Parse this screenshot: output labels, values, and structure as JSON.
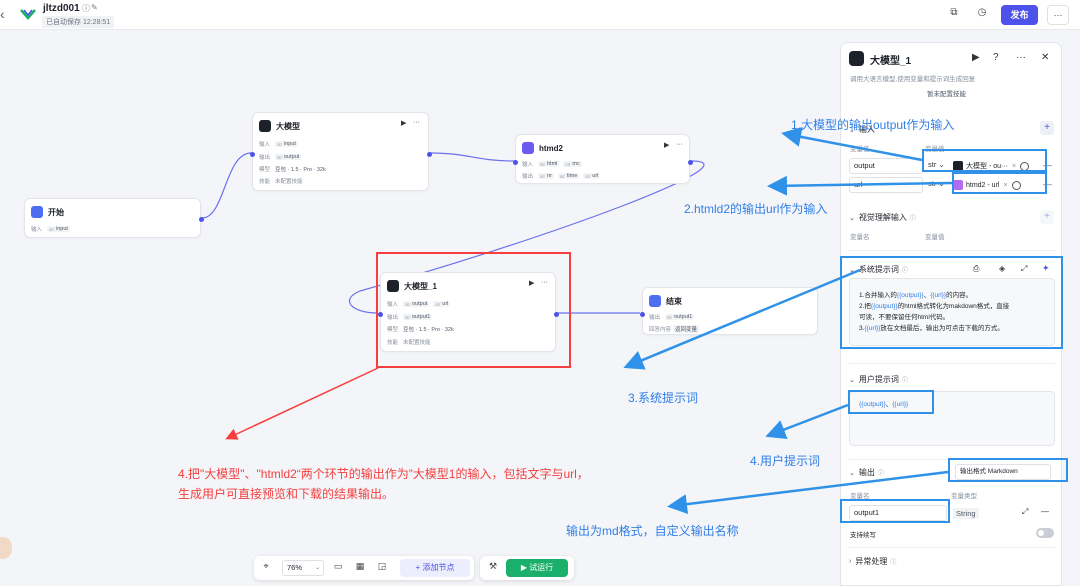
{
  "topbar": {
    "project_name": "jltzd001",
    "autosave": "已自动保存 12:28:51",
    "publish_label": "发布",
    "more_label": "···"
  },
  "nodes": {
    "start": {
      "title": "开始",
      "row_label": "输入",
      "output_type": "str",
      "output_name": "input"
    },
    "llm": {
      "title": "大模型",
      "in_label": "输入",
      "in_name": "input",
      "out_label": "输出",
      "out_name": "output",
      "model_label": "模型",
      "model_value": "豆包 · 1.5 · Pro · 32k",
      "skill_label": "技能",
      "skill_value": "未配置技能"
    },
    "htmd2": {
      "title": "htmd2",
      "in_label": "输入",
      "in_a": "html",
      "in_b": "mc",
      "out_label": "输出",
      "out_a": "nr",
      "out_b": "time",
      "out_c": "url"
    },
    "llm1": {
      "title": "大模型_1",
      "in_label": "输入",
      "in_a": "output",
      "in_b": "url",
      "out_label": "输出",
      "out_name": "output1",
      "model_label": "模型",
      "model_value": "豆包 · 1.5 · Pro · 32k",
      "skill_label": "技能",
      "skill_value": "未配置技能"
    },
    "end": {
      "title": "结束",
      "out_label": "输出",
      "out_name": "output1",
      "answer_label": "回答内容",
      "answer_value": "返回变量"
    }
  },
  "annotations": {
    "a1": "1.大模型的输出output作为输入",
    "a2": "2.htmld2的输出url作为输入",
    "a3": "3.系统提示词",
    "a4": "4.用户提示词",
    "a5": "输出为md格式，自定义输出名称",
    "red_line1": "4.把\"大模型\"、\"htmld2“两个环节的输出作为”大模型1的输入，包括文字与url，",
    "red_line2": "生成用户可直接预览和下载的结果输出。"
  },
  "toolbar": {
    "zoom": "76%",
    "add_node": "添加节点",
    "run": "试运行"
  },
  "panel": {
    "title": "大模型_1",
    "desc": "调用大语言模型,使用变量和提示词生成回复",
    "desc2": "暂未配置技能",
    "input_section": "输入",
    "col_name": "变量名",
    "col_value": "变量值",
    "inputs": [
      {
        "name": "output",
        "type": "str",
        "ref": "大模型 - ou···"
      },
      {
        "name": "url",
        "type": "str",
        "ref": "htmd2 - url"
      }
    ],
    "vision_section": "视觉理解输入",
    "vision_col_name": "变量名",
    "vision_col_value": "变量值",
    "system_prompt_section": "系统提示词",
    "system_prompt": [
      {
        "a": "1.合并输入的",
        "v1": "{{output}}",
        "b": "、",
        "v2": "{{url}}",
        "c": "的内容。"
      },
      {
        "a": "2.把",
        "v1": "{{output}}",
        "b": "的html格式转化为makdown格式，直接",
        "v2": "",
        "c": ""
      },
      {
        "a": "可读，不要保留任何html代码。",
        "v1": "",
        "b": "",
        "v2": "",
        "c": ""
      },
      {
        "a": "3.",
        "v1": "{{url}}",
        "b": "放在文档最后，输出为可点击下载的方式。",
        "v2": "",
        "c": ""
      }
    ],
    "user_prompt_section": "用户提示词",
    "user_prompt_v1": "{{output}}",
    "user_prompt_sep": "、",
    "user_prompt_v2": "{{url}}",
    "output_section": "输出",
    "output_format": "输出格式 Markdown",
    "out_col_name": "变量名",
    "out_col_type": "变量类型",
    "output_name": "output1",
    "output_type": "String",
    "stream_label": "支持续写",
    "exception_section": "异常处理"
  },
  "colors": {
    "accent": "#4d53e8",
    "annotation_blue": "#2f7ee8",
    "annotation_red": "#f53f3f",
    "run_green": "#1ab06b"
  }
}
